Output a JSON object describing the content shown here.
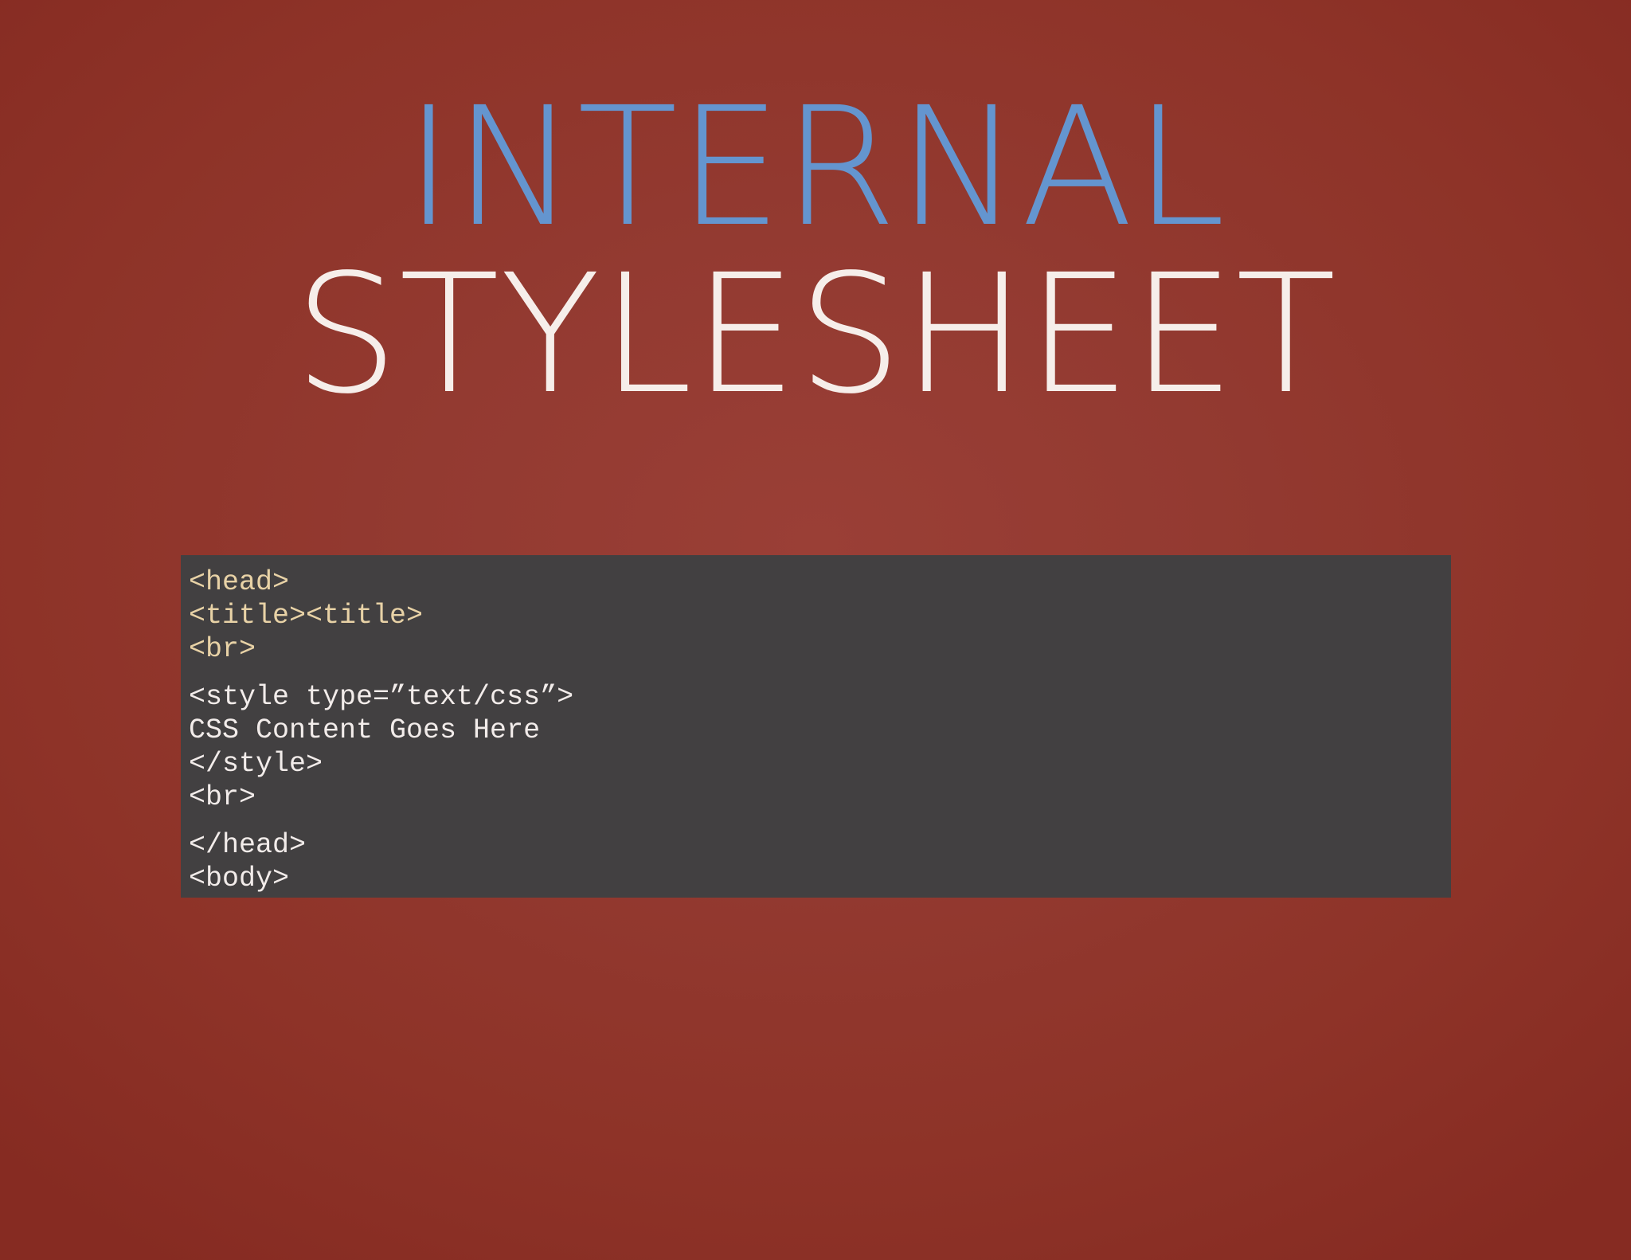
{
  "slide": {
    "title_line1": "INTERNAL",
    "title_line2": "STYLESHEET",
    "colors": {
      "background": "#933a31",
      "title_accent": "#6495cf",
      "title_light": "#f6eeea",
      "code_background": "#424041",
      "code_tag": "#e8d2a6",
      "code_text": "#f2ecea"
    }
  },
  "code": {
    "group1": [
      "<head>",
      "<title><title>",
      "<br>"
    ],
    "group2": [
      "<style type=”text/css”>",
      "CSS Content Goes Here",
      "</style>",
      "<br>"
    ],
    "group3": [
      "</head>",
      "<body>"
    ]
  }
}
